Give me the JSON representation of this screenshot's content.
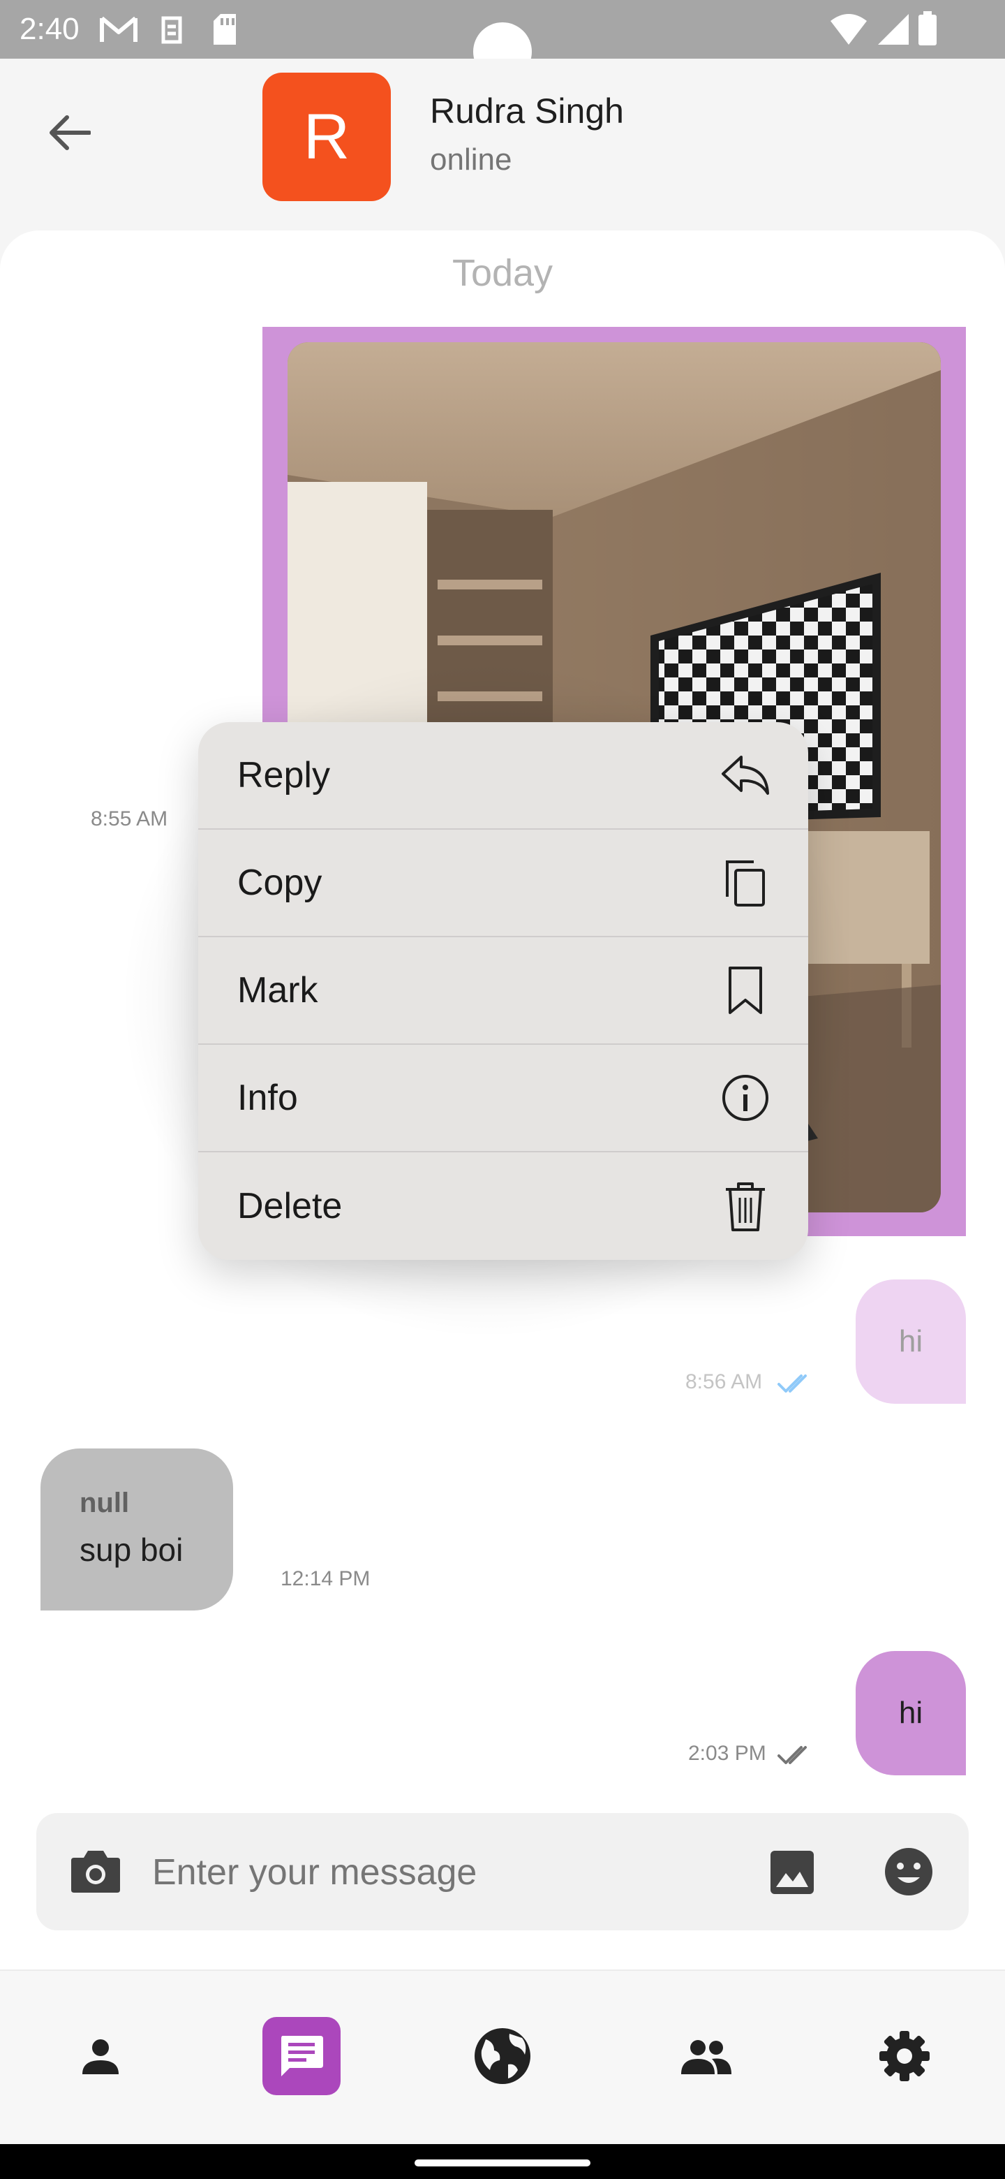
{
  "status_bar": {
    "time": "2:40"
  },
  "header": {
    "avatar_letter": "R",
    "name": "Rudra Singh",
    "status": "online"
  },
  "chat": {
    "date_separator": "Today",
    "messages": [
      {
        "type": "image",
        "direction": "outgoing",
        "time": "8:55 AM"
      },
      {
        "type": "text",
        "direction": "outgoing",
        "text": "hi",
        "time": "8:56 AM"
      },
      {
        "type": "text",
        "direction": "incoming",
        "sender": "null",
        "text": "sup boi",
        "time": "12:14 PM"
      },
      {
        "type": "text",
        "direction": "outgoing",
        "text": "hi",
        "time": "2:03 PM"
      }
    ]
  },
  "input": {
    "placeholder": "Enter your message"
  },
  "context_menu": {
    "items": [
      {
        "label": "Reply",
        "icon": "reply-icon"
      },
      {
        "label": "Copy",
        "icon": "copy-icon"
      },
      {
        "label": "Mark",
        "icon": "bookmark-icon"
      },
      {
        "label": "Info",
        "icon": "info-icon"
      },
      {
        "label": "Delete",
        "icon": "trash-icon"
      }
    ]
  },
  "bottom_nav": {
    "items": [
      {
        "icon": "person-icon",
        "active": false
      },
      {
        "icon": "chat-icon",
        "active": true
      },
      {
        "icon": "globe-icon",
        "active": false
      },
      {
        "icon": "group-icon",
        "active": false
      },
      {
        "icon": "gear-icon",
        "active": false
      }
    ]
  },
  "colors": {
    "accent": "#ab47bc",
    "bubble_outgoing": "#ce93d8",
    "bubble_outgoing_dimmed": "#eed4f2",
    "bubble_incoming": "#bdbdbd",
    "avatar": "#f4511e",
    "status_bar": "#a6a6a6",
    "read_ticks_blue": "#64b5f6"
  }
}
